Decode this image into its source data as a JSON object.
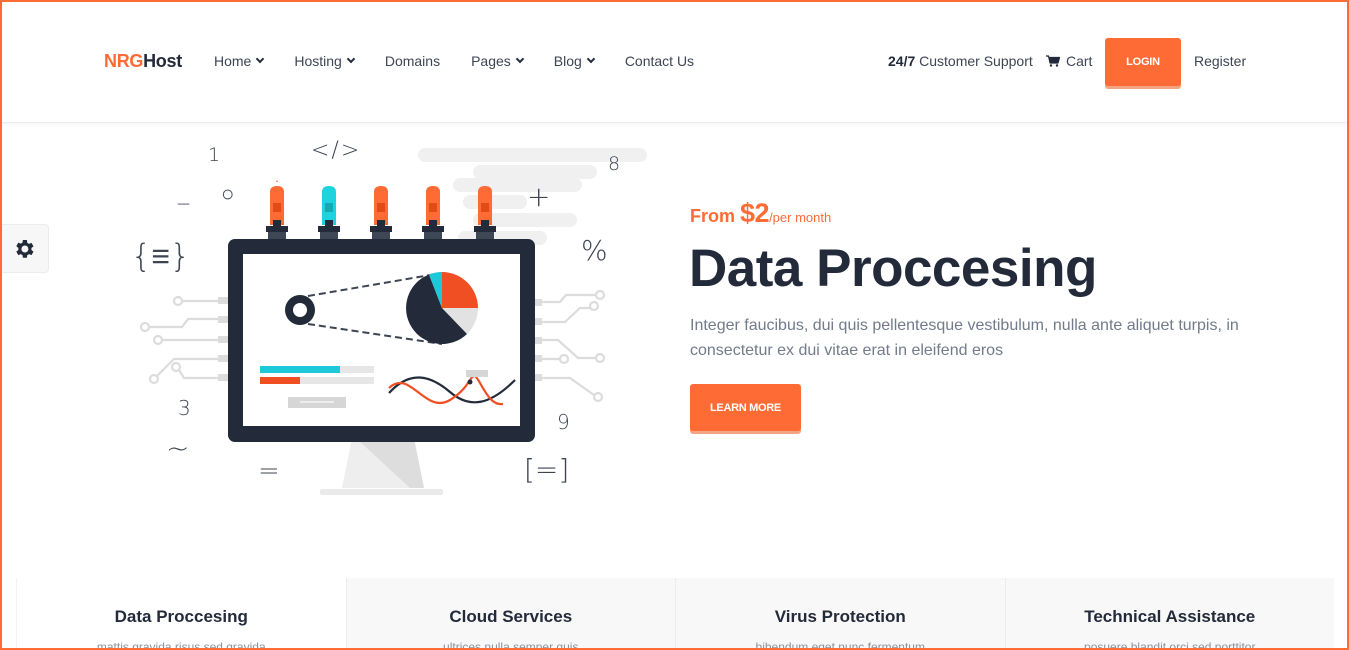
{
  "brand": {
    "logo_part1": "NRG",
    "logo_part2": "Host",
    "accent_color": "#ff6b35",
    "dark_color": "#232b3a"
  },
  "nav": {
    "items": [
      {
        "label": "Home",
        "has_dropdown": true
      },
      {
        "label": "Hosting",
        "has_dropdown": true
      },
      {
        "label": "Domains",
        "has_dropdown": false
      },
      {
        "label": "Pages",
        "has_dropdown": true
      },
      {
        "label": "Blog",
        "has_dropdown": true
      },
      {
        "label": "Contact Us",
        "has_dropdown": false
      }
    ]
  },
  "header_right": {
    "support_bold": "24/7",
    "support_text": " Customer Support",
    "cart_label": "Cart",
    "cart_icon": "shopping-cart-icon",
    "login_label": "LOGIN",
    "register_label": "Register"
  },
  "settings": {
    "icon": "gear-icon"
  },
  "illustration": {
    "symbols": [
      "1",
      "</>",
      "8",
      "_",
      "○",
      "+",
      "{≡}",
      "%",
      "3",
      "~",
      "9",
      "=",
      "[=]"
    ],
    "pie_colors": [
      "#f04e23",
      "#e2e2e2",
      "#232b3a",
      "#1dc9d8"
    ],
    "bulb_colors": [
      "#ff6b35",
      "#1dd3de",
      "#ff6b35",
      "#ff6b35",
      "#ff6b35"
    ]
  },
  "hero": {
    "price_prefix": "From ",
    "price_amount": "$2",
    "price_period": "/per month",
    "title": "Data Proccesing",
    "description": "Integer faucibus, dui quis pellentesque vestibulum, nulla ante aliquet turpis, in consectetur ex dui vitae erat in eleifend eros",
    "cta_label": "LEARN MORE"
  },
  "features": [
    {
      "title": "Data Proccesing",
      "subtitle": "mattis gravida risus sed gravida"
    },
    {
      "title": "Cloud Services",
      "subtitle": "ultrices nulla semper quis"
    },
    {
      "title": "Virus Protection",
      "subtitle": "bibendum eget nunc fermentum"
    },
    {
      "title": "Technical Assistance",
      "subtitle": "posuere blandit orci sed porttitor"
    }
  ]
}
